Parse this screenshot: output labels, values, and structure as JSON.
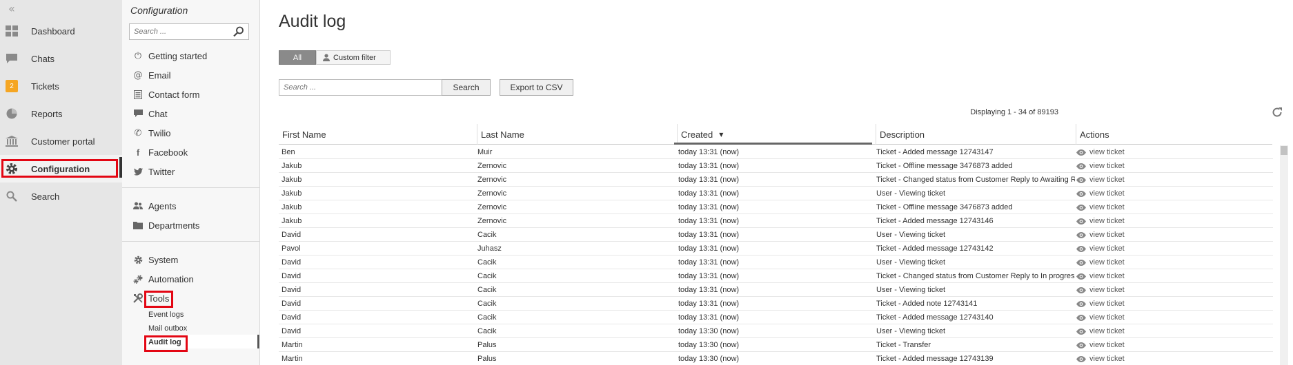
{
  "nav": {
    "items": [
      {
        "label": "Dashboard",
        "icon": "dashboard-icon"
      },
      {
        "label": "Chats",
        "icon": "chat-bubble-icon"
      },
      {
        "label": "Tickets",
        "icon": "tickets-badge-icon",
        "badge": "2"
      },
      {
        "label": "Reports",
        "icon": "pie-chart-icon"
      },
      {
        "label": "Customer portal",
        "icon": "bank-building-icon"
      },
      {
        "label": "Configuration",
        "icon": "gear-icon",
        "active": true
      },
      {
        "label": "Search",
        "icon": "search-icon"
      }
    ],
    "collapse_icon": "double-chevron-left-icon",
    "colors": {
      "badge": "#f5a623",
      "highlight": "#e30613"
    }
  },
  "config": {
    "title": "Configuration",
    "search_placeholder": "Search ...",
    "group1": [
      {
        "label": "Getting started",
        "icon": "power-icon"
      },
      {
        "label": "Email",
        "icon": "at-icon"
      },
      {
        "label": "Contact form",
        "icon": "form-icon"
      },
      {
        "label": "Chat",
        "icon": "chat-icon"
      },
      {
        "label": "Twilio",
        "icon": "phone-icon"
      },
      {
        "label": "Facebook",
        "icon": "facebook-icon"
      },
      {
        "label": "Twitter",
        "icon": "twitter-icon"
      }
    ],
    "group2": [
      {
        "label": "Agents",
        "icon": "agents-icon"
      },
      {
        "label": "Departments",
        "icon": "folder-icon"
      }
    ],
    "group3": [
      {
        "label": "System",
        "icon": "gear-icon"
      },
      {
        "label": "Automation",
        "icon": "gears-icon"
      },
      {
        "label": "Tools",
        "icon": "tools-icon"
      }
    ],
    "tools_sub": [
      "Event logs",
      "Mail outbox",
      "Audit log"
    ]
  },
  "main": {
    "title": "Audit log",
    "filter_all": "All",
    "filter_custom": "Custom filter",
    "search_placeholder": "Search ...",
    "search_button": "Search",
    "export_button": "Export to CSV",
    "displaying": "Displaying 1 - 34 of 89193",
    "columns": [
      "First Name",
      "Last Name",
      "Created",
      "Description",
      "Actions"
    ],
    "action_label": "view ticket",
    "rows": [
      [
        "Ben",
        "Muir",
        "today 13:31 (now)",
        "Ticket - Added message 12743147"
      ],
      [
        "Jakub",
        "Zernovic",
        "today 13:31 (now)",
        "Ticket - Offline message 3476873 added"
      ],
      [
        "Jakub",
        "Zernovic",
        "today 13:31 (now)",
        "Ticket - Changed status from Customer Reply to Awaiting Reply"
      ],
      [
        "Jakub",
        "Zernovic",
        "today 13:31 (now)",
        "User - Viewing ticket"
      ],
      [
        "Jakub",
        "Zernovic",
        "today 13:31 (now)",
        "Ticket - Offline message 3476873 added"
      ],
      [
        "Jakub",
        "Zernovic",
        "today 13:31 (now)",
        "Ticket - Added message 12743146"
      ],
      [
        "David",
        "Cacik",
        "today 13:31 (now)",
        "User - Viewing ticket"
      ],
      [
        "Pavol",
        "Juhasz",
        "today 13:31 (now)",
        "Ticket - Added message 12743142"
      ],
      [
        "David",
        "Cacik",
        "today 13:31 (now)",
        "User - Viewing ticket"
      ],
      [
        "David",
        "Cacik",
        "today 13:31 (now)",
        "Ticket - Changed status from Customer Reply to In progress"
      ],
      [
        "David",
        "Cacik",
        "today 13:31 (now)",
        "User - Viewing ticket"
      ],
      [
        "David",
        "Cacik",
        "today 13:31 (now)",
        "Ticket - Added note 12743141"
      ],
      [
        "David",
        "Cacik",
        "today 13:31 (now)",
        "Ticket - Added message 12743140"
      ],
      [
        "David",
        "Cacik",
        "today 13:30 (now)",
        "User - Viewing ticket"
      ],
      [
        "Martin",
        "Palus",
        "today 13:30 (now)",
        "Ticket - Transfer"
      ],
      [
        "Martin",
        "Palus",
        "today 13:30 (now)",
        "Ticket - Added message 12743139"
      ]
    ]
  }
}
